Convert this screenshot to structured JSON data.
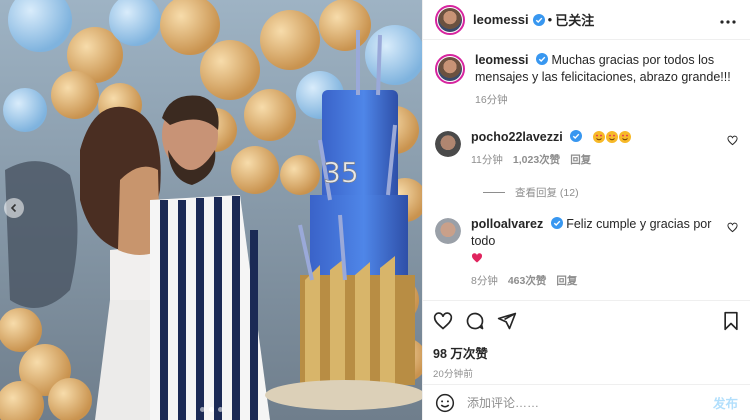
{
  "post": {
    "author": "leomessi",
    "follow_label": "已关注",
    "separator": "•",
    "caption": "Muchas gracias por todos los mensajes y las felicitaciones, abrazo grande!!!",
    "caption_time": "16分钟",
    "cake_number": "35"
  },
  "comments": [
    {
      "username": "pocho22lavezzi",
      "text": "",
      "emojis": [
        "heart-eyes-emoji",
        "heart-eyes-emoji",
        "heart-eyes-emoji"
      ],
      "time": "11分钟",
      "likes": "1,023次赞",
      "reply_label": "回复",
      "view_replies": "查看回复 (12)"
    },
    {
      "username": "polloalvarez",
      "text": "Feliz cumple y gracias por todo",
      "emojis": [
        "red-heart-emoji"
      ],
      "time": "8分钟",
      "likes": "463次赞",
      "reply_label": "回复"
    }
  ],
  "stats": {
    "likes": "98 万次赞",
    "time_ago": "20分钟前"
  },
  "composer": {
    "placeholder": "添加评论……",
    "post_label": "发布"
  },
  "colors": {
    "verified": "#3897f0",
    "post_button": "#b2dffc",
    "heart": "#ed4956"
  }
}
